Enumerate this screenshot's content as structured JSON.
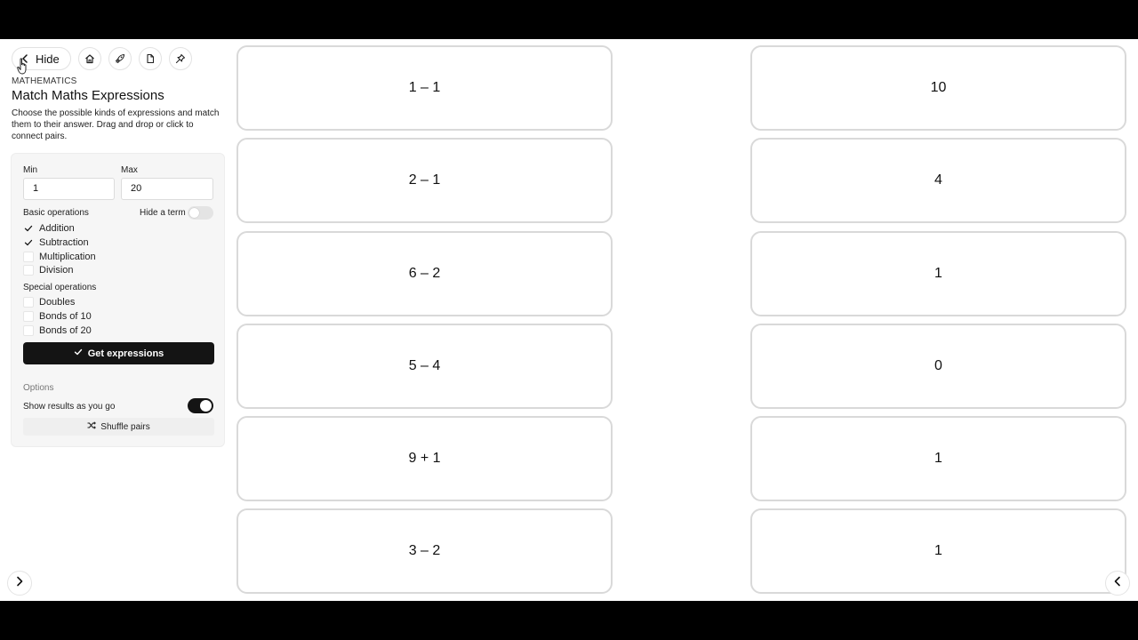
{
  "toolbar": {
    "hide_label": "Hide",
    "icons": [
      "chevron-left-icon",
      "home-icon",
      "rocket-icon",
      "document-icon",
      "pin-icon"
    ]
  },
  "sidebar": {
    "eyebrow": "MATHEMATICS",
    "title": "Match Maths Expressions",
    "description": "Choose the possible kinds of expressions and match them to their answer. Drag and drop or click to connect pairs."
  },
  "settings": {
    "min_label": "Min",
    "min_value": "1",
    "max_label": "Max",
    "max_value": "20",
    "basic_label": "Basic operations",
    "hide_term_label": "Hide a term",
    "hide_term_on": false,
    "basic_ops": [
      {
        "label": "Addition",
        "checked": true
      },
      {
        "label": "Subtraction",
        "checked": true
      },
      {
        "label": "Multiplication",
        "checked": false
      },
      {
        "label": "Division",
        "checked": false
      }
    ],
    "special_label": "Special operations",
    "special_ops": [
      {
        "label": "Doubles",
        "checked": false
      },
      {
        "label": "Bonds of 10",
        "checked": false
      },
      {
        "label": "Bonds of 20",
        "checked": false
      }
    ],
    "get_button": "Get expressions",
    "options_label": "Options",
    "show_results_label": "Show results as you go",
    "show_results_on": true,
    "shuffle_button": "Shuffle pairs"
  },
  "expressions": [
    "1 – 1",
    "2 – 1",
    "6 – 2",
    "5 – 4",
    "9 + 1",
    "3 – 2"
  ],
  "answers": [
    "10",
    "4",
    "1",
    "0",
    "1",
    "1"
  ],
  "colors": {
    "primary": "#141414",
    "tile_border": "#d9d9d9",
    "card_bg": "#f6f6f6"
  }
}
